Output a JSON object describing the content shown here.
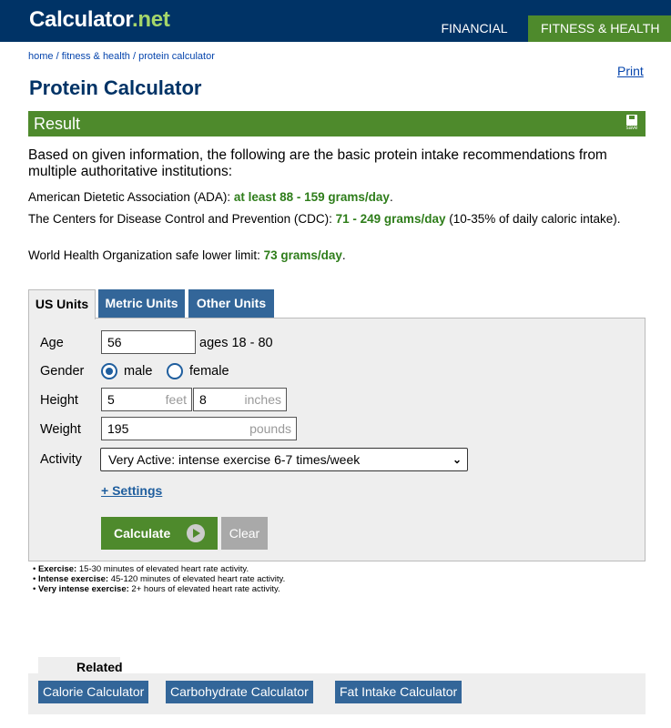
{
  "header": {
    "logo_main": "Calculator",
    "logo_suffix": ".net",
    "nav": [
      {
        "label": "FINANCIAL"
      },
      {
        "label": "FITNESS & HEALTH"
      }
    ]
  },
  "breadcrumb": {
    "home": "home",
    "sep1": " / ",
    "fitness": "fitness & health",
    "sep2": " / ",
    "current": "protein calculator"
  },
  "print_label": "Print",
  "page_title": "Protein Calculator",
  "result": {
    "title": "Result",
    "save_label": "save",
    "intro": "Based on given information, the following are the basic protein intake recommendations from multiple authoritative institutions:",
    "lines": [
      {
        "prefix": "American Dietetic Association (ADA): ",
        "value": "at least 88 - 159 grams/day",
        "suffix": "."
      },
      {
        "prefix": "The Centers for Disease Control and Prevention (CDC): ",
        "value": "71 - 249 grams/day",
        "suffix": " (10-35% of daily caloric intake)."
      },
      {
        "prefix": "World Health Organization safe lower limit: ",
        "value": "73 grams/day",
        "suffix": "."
      }
    ]
  },
  "tabs": [
    "US Units",
    "Metric Units",
    "Other Units"
  ],
  "form": {
    "age_label": "Age",
    "age_value": "56",
    "age_hint": "ages 18 - 80",
    "gender_label": "Gender",
    "gender_options": [
      "male",
      "female"
    ],
    "gender_selected": "male",
    "height_label": "Height",
    "height_feet": "5",
    "height_feet_unit": "feet",
    "height_inches": "8",
    "height_inches_unit": "inches",
    "weight_label": "Weight",
    "weight_value": "195",
    "weight_unit": "pounds",
    "activity_label": "Activity",
    "activity_value": "Very Active: intense exercise 6-7 times/week",
    "settings_link": "+ Settings",
    "calculate_label": "Calculate",
    "clear_label": "Clear"
  },
  "notes": [
    {
      "term": "Exercise:",
      "text": " 15-30 minutes of elevated heart rate activity."
    },
    {
      "term": "Intense exercise:",
      "text": " 45-120 minutes of elevated heart rate activity."
    },
    {
      "term": "Very intense exercise:",
      "text": " 2+ hours of elevated heart rate activity."
    }
  ],
  "related": {
    "title": "Related",
    "links": [
      "Calorie Calculator",
      "Carbohydrate Calculator",
      "Fat Intake Calculator"
    ]
  },
  "colors": {
    "header_bg": "#003366",
    "accent_green": "#4e8a2c",
    "tab_blue": "#336699",
    "result_green_text": "#2e7d1a"
  }
}
